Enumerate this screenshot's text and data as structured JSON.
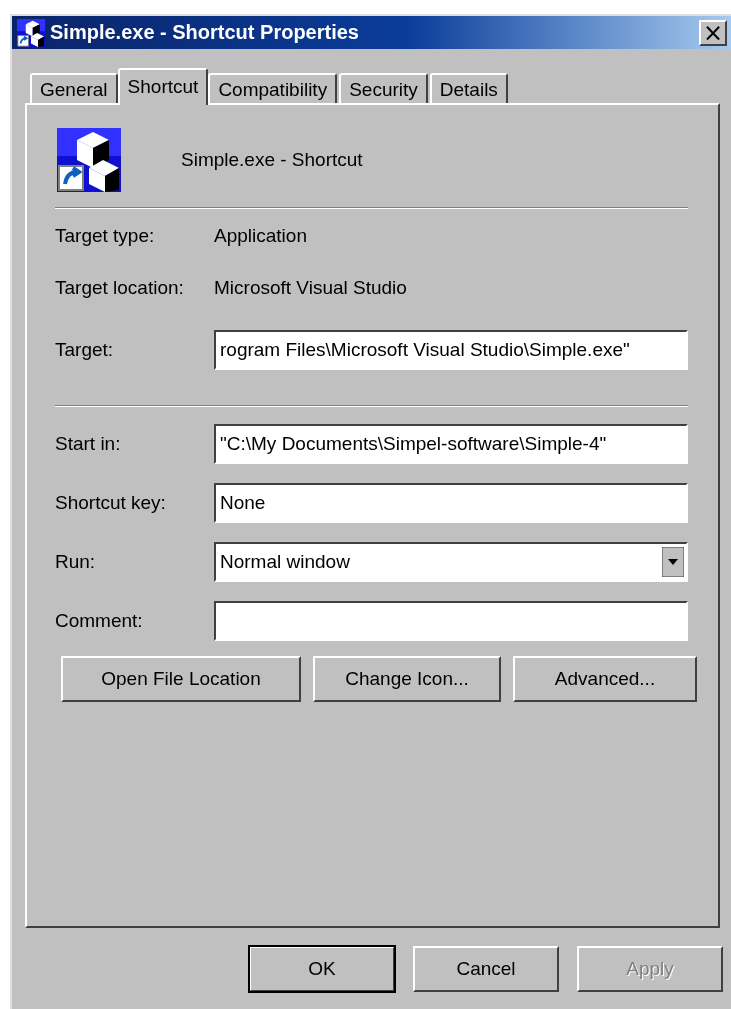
{
  "window": {
    "title": "Simple.exe - Shortcut Properties",
    "close": "×"
  },
  "tabs": [
    {
      "label": "General",
      "selected": false
    },
    {
      "label": "Shortcut",
      "selected": true
    },
    {
      "label": "Compatibility",
      "selected": false
    },
    {
      "label": "Security",
      "selected": false
    },
    {
      "label": "Details",
      "selected": false
    }
  ],
  "header": {
    "name": "Simple.exe - Shortcut"
  },
  "info": [
    {
      "label": "Target type:",
      "value": "Application"
    },
    {
      "label": "Target location:",
      "value": "Microsoft Visual Studio"
    }
  ],
  "field_groups": [
    [
      {
        "kind": "text",
        "label": "Target:",
        "value": "rogram Files\\Microsoft Visual Studio\\Simple.exe\""
      }
    ],
    [
      {
        "kind": "text",
        "label": "Start in:",
        "value": "\"C:\\My Documents\\Simpel-software\\Simple-4\""
      },
      {
        "kind": "text",
        "label": "Shortcut key:",
        "value": "None"
      },
      {
        "kind": "dropdown",
        "label": "Run:",
        "value": "Normal window"
      },
      {
        "kind": "text",
        "label": "Comment:"
      }
    ]
  ],
  "actions": [
    "Open File Location",
    "Change Icon...",
    "Advanced..."
  ],
  "buttons": [
    {
      "label": "OK",
      "default": true,
      "disabled": false
    },
    {
      "label": "Cancel",
      "default": false,
      "disabled": false
    },
    {
      "label": "Apply",
      "default": false,
      "disabled": true
    }
  ]
}
